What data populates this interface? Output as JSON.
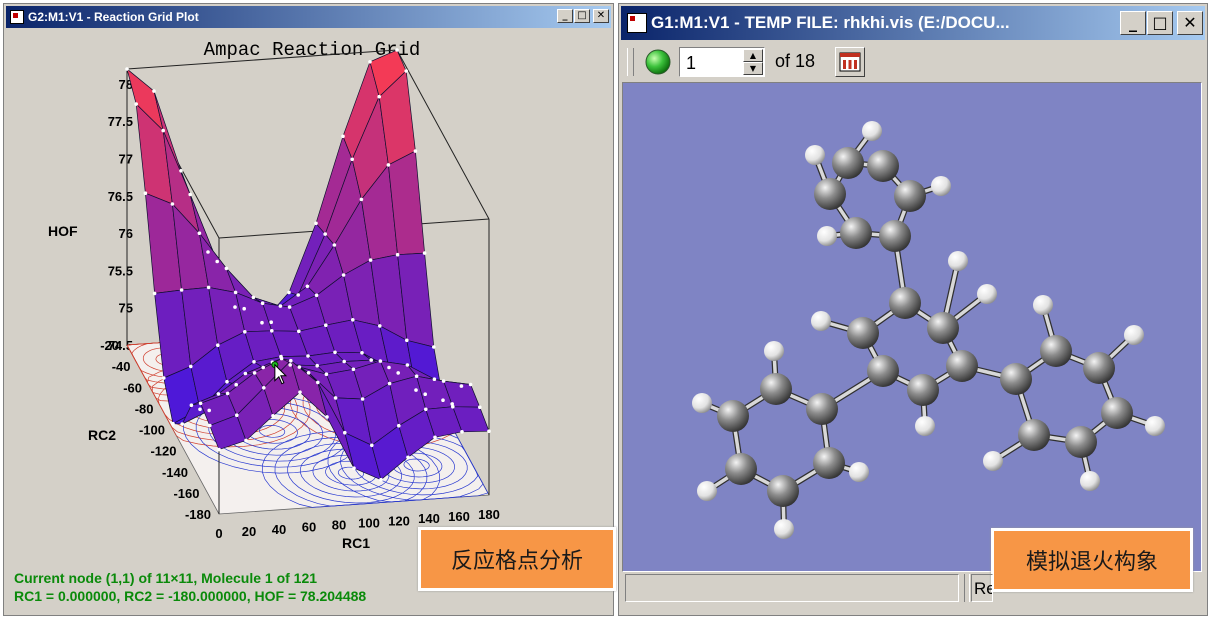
{
  "left_window": {
    "title": "G2:M1:V1 - Reaction Grid Plot",
    "plot_title": "Ampac Reaction Grid",
    "z_label": "HOF",
    "y_label": "RC2",
    "x_label": "RC1",
    "z_ticks": [
      "78",
      "77.5",
      "77",
      "76.5",
      "76",
      "75.5",
      "75",
      "74.5"
    ],
    "y_ticks": [
      "-20",
      "-40",
      "-60",
      "-80",
      "-100",
      "-120",
      "-140",
      "-160",
      "-180"
    ],
    "x_ticks": [
      "0",
      "20",
      "40",
      "60",
      "80",
      "100",
      "120",
      "140",
      "160",
      "180"
    ],
    "status_line1": "Current node (1,1) of 11×11, Molecule 1 of 121",
    "status_line2": "RC1 = 0.000000, RC2 = -180.000000, HOF = 78.204488"
  },
  "right_window": {
    "title": "G1:M1:V1 - TEMP FILE:  rhkhi.vis (E:/DOCU...",
    "frame_value": "1",
    "of_label": "of 18",
    "status_right": "Re"
  },
  "labels": {
    "left": "反应格点分析",
    "right": "模拟退火构象"
  },
  "colors": {
    "title_bar": "#0a246a",
    "viewer_bg": "#7f84c4",
    "label_box": "#f79646",
    "status_text": "#0a8a0a"
  }
}
